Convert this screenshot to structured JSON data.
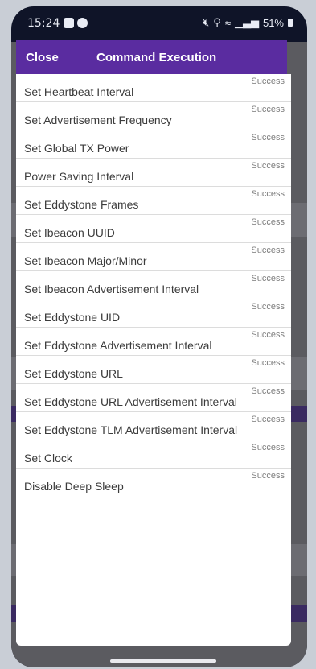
{
  "status_bar": {
    "time": "15:24",
    "battery": "51%"
  },
  "modal": {
    "close_label": "Close",
    "title": "Command Execution",
    "commands": [
      {
        "label": "Set Heartbeat Interval",
        "status": "Success"
      },
      {
        "label": "Set Advertisement Frequency",
        "status": "Success"
      },
      {
        "label": "Set Global TX Power",
        "status": "Success"
      },
      {
        "label": "Power Saving Interval",
        "status": "Success"
      },
      {
        "label": "Set Eddystone Frames",
        "status": "Success"
      },
      {
        "label": "Set Ibeacon UUID",
        "status": "Success"
      },
      {
        "label": "Set Ibeacon Major/Minor",
        "status": "Success"
      },
      {
        "label": "Set Ibeacon Advertisement Interval",
        "status": "Success"
      },
      {
        "label": "Set Eddystone UID",
        "status": "Success"
      },
      {
        "label": "Set Eddystone Advertisement Interval",
        "status": "Success"
      },
      {
        "label": "Set Eddystone URL",
        "status": "Success"
      },
      {
        "label": "Set Eddystone URL Advertisement Interval",
        "status": "Success"
      },
      {
        "label": "Set Eddystone TLM Advertisement Interval",
        "status": "Success"
      },
      {
        "label": "Set Clock",
        "status": "Success"
      },
      {
        "label": "Disable Deep Sleep",
        "status": "Success"
      }
    ]
  },
  "colors": {
    "header_purple": "#5a2ca0",
    "background_purple": "#3a2a61",
    "background_gray": "#5b5b60"
  }
}
